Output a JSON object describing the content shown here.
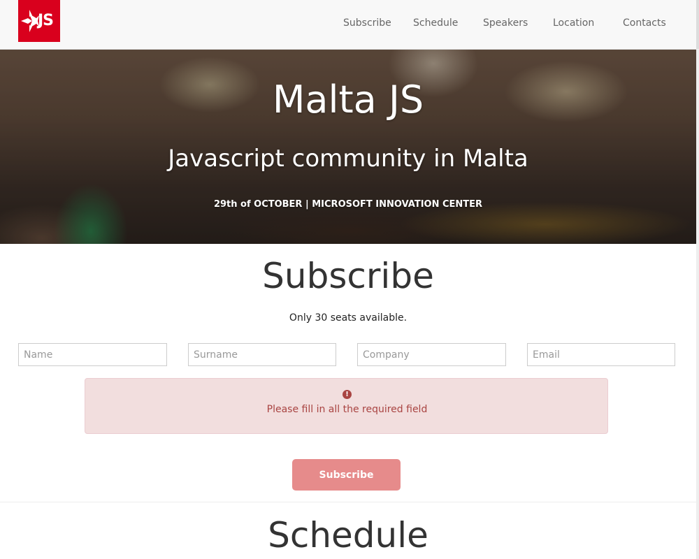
{
  "brand": {
    "logo_text": "JS",
    "logo_color": "#d9001d"
  },
  "nav": {
    "items": [
      {
        "label": "Subscribe"
      },
      {
        "label": "Schedule"
      },
      {
        "label": "Speakers"
      },
      {
        "label": "Location"
      },
      {
        "label": "Contacts"
      }
    ]
  },
  "hero": {
    "title": "Malta JS",
    "subtitle": "Javascript community in Malta",
    "date_line": "29th of OCTOBER | MICROSOFT INNOVATION CENTER"
  },
  "subscribe": {
    "title": "Subscribe",
    "seats_text": "Only 30 seats available.",
    "fields": {
      "name": {
        "placeholder": "Name",
        "value": ""
      },
      "surname": {
        "placeholder": "Surname",
        "value": ""
      },
      "company": {
        "placeholder": "Company",
        "value": ""
      },
      "email": {
        "placeholder": "Email",
        "value": ""
      }
    },
    "alert": {
      "icon": "exclamation-circle-icon",
      "text": "Please fill in all the required field",
      "color": "#a94442",
      "background": "#f2dede"
    },
    "button_label": "Subscribe",
    "button_color": "#e68b8b"
  },
  "schedule": {
    "title": "Schedule"
  }
}
